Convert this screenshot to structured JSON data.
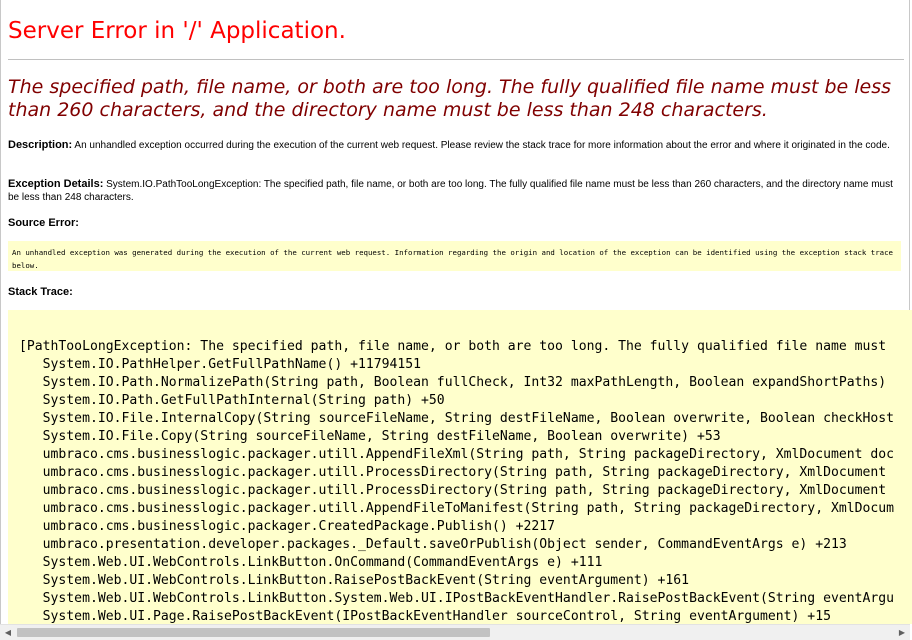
{
  "page": {
    "title": "Server Error in '/' Application.",
    "error_message": "The specified path, file name, or both are too long. The fully qualified file name must be less than 260 characters, and the directory name must be less than 248 characters.",
    "description_label": "Description:",
    "description_text": " An unhandled exception occurred during the execution of the current web request. Please review the stack trace for more information about the error and where it originated in the code.",
    "exception_label": "Exception Details:",
    "exception_text": " System.IO.PathTooLongException: The specified path, file name, or both are too long. The fully qualified file name must be less than 260 characters, and the directory name must be less than 248 characters.",
    "source_error_label": "Source Error:",
    "source_error_text": "An unhandled exception was generated during the execution of the current web request. Information regarding the origin and location of the exception can be identified using the exception stack trace below.",
    "stack_trace_label": "Stack Trace:"
  },
  "stack_trace": [
    "[PathTooLongException: The specified path, file name, or both are too long. The fully qualified file name must",
    "   System.IO.PathHelper.GetFullPathName() +11794151",
    "   System.IO.Path.NormalizePath(String path, Boolean fullCheck, Int32 maxPathLength, Boolean expandShortPaths)",
    "   System.IO.Path.GetFullPathInternal(String path) +50",
    "   System.IO.File.InternalCopy(String sourceFileName, String destFileName, Boolean overwrite, Boolean checkHost",
    "   System.IO.File.Copy(String sourceFileName, String destFileName, Boolean overwrite) +53",
    "   umbraco.cms.businesslogic.packager.utill.AppendFileXml(String path, String packageDirectory, XmlDocument doc",
    "   umbraco.cms.businesslogic.packager.utill.ProcessDirectory(String path, String packageDirectory, XmlDocument",
    "   umbraco.cms.businesslogic.packager.utill.ProcessDirectory(String path, String packageDirectory, XmlDocument",
    "   umbraco.cms.businesslogic.packager.utill.AppendFileToManifest(String path, String packageDirectory, XmlDocum",
    "   umbraco.cms.businesslogic.packager.CreatedPackage.Publish() +2217",
    "   umbraco.presentation.developer.packages._Default.saveOrPublish(Object sender, CommandEventArgs e) +213",
    "   System.Web.UI.WebControls.LinkButton.OnCommand(CommandEventArgs e) +111",
    "   System.Web.UI.WebControls.LinkButton.RaisePostBackEvent(String eventArgument) +161",
    "   System.Web.UI.WebControls.LinkButton.System.Web.UI.IPostBackEventHandler.RaisePostBackEvent(String eventArgu",
    "   System.Web.UI.Page.RaisePostBackEvent(IPostBackEventHandler sourceControl, String eventArgument) +15"
  ],
  "scrollbar": {
    "left_arrow_icon": "left-arrow-icon",
    "right_arrow_icon": "right-arrow-icon",
    "thumb_fraction": 0.54
  }
}
